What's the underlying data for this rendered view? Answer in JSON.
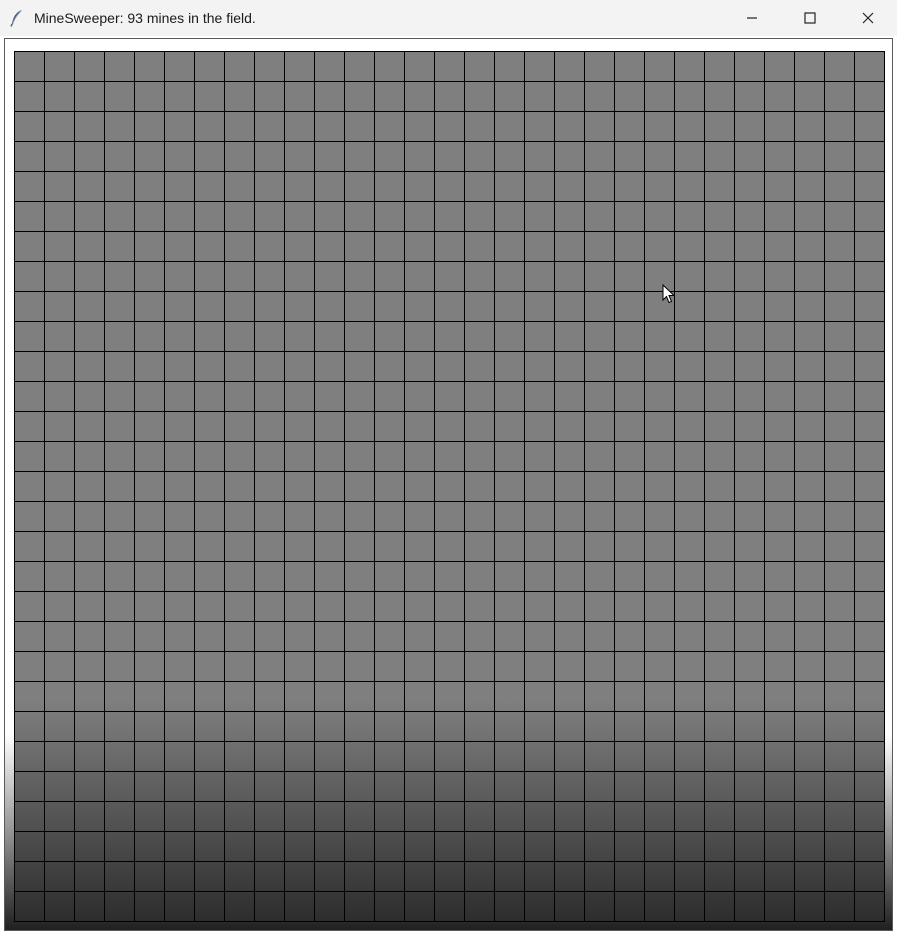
{
  "window": {
    "title": "MineSweeper: 93 mines in the field.",
    "icon": "feather-icon",
    "controls": [
      "minimize-icon",
      "maximize-icon",
      "close-icon"
    ]
  },
  "board": {
    "rows": 29,
    "cols": 29,
    "legend": {
      "H": "hidden",
      ".": "revealed-empty",
      "M": "mine",
      "digit": "revealed-number"
    },
    "grid": [
      "HHHHHHHHHHHHHHHHHHHHHHHHHHHHH",
      "HHHHHHHHHHHHHHHHHHHHHHHHHHHHH",
      "HHHHHHHHHHHHHHHHHHHHHHHHHHHHH",
      "HHHHHHHHHHHHHHHHHHHHHHHHHHHHH",
      "HHHHHHHHHHHHHHHHHHHHHHHHHHHHH",
      "HHHHHHHHHHHHHHHHHHHHHHHHHHHHH",
      "HHHHHHHHHHHHHHHHHHHHHHHHHHHHH",
      "HHHHHHHHHHHHHHHHHHHHHHHHHHHHH",
      "HHHHHHHHHHHHHHHHHHHHHHHHHHHHH",
      "HHHHHHHHHHHHHHHHHHHHHHHHHHHHH",
      "HHHHHHHHHHHHHHHHHHHHHHHHHHHHH",
      "HHHHHHHHHHHHHHHHHHHHHHHHHHHHH",
      "HHHHHHHHHHHHHHHHHHHHHHHHHHHHH",
      "HHHHHHHHHHHHHHHHHHHHHHHHHHHHH",
      "HHHHHHHHHHHHHHHHHHHHHHHHHHHHH",
      "HHHHHHHHHHHHHHHHHHHHHHHHHHHHH",
      "HHHHHHHHHHHHHHHHHHHHHHHHHHHHH",
      "HHHHHHHHHHHHHHHHHHHHHHHHHHHHH",
      "HHHHHHHHHHHHHHHHHHHHHHHHHHHHH",
      "HHHHHHHHHHHHHHHHHHHHHHHHHHHHH",
      "HHHHHHHHHHHHHHHHHHHHHHHHHHHHH",
      "HHHHHHHHHHHHHHHHHHHHHHHHHHHHH",
      "HHHHHHHHHHHHHHHHHHHHHHHHHHHHH",
      "HHHHHHHHHHHHHHHHHHHHHHHHHHHHH",
      "HHHHHHHHHHHHHHHHHHHHHHHHHHHHH",
      "HHHHHHHHHHHHHHHHHHHHHHHHHHHHH",
      "HHHHHHHHHHHHHHHHHHHHHHHHHHHHH",
      "HHHHHHHHHHHHHHHHHHHHHHHHHHHHH",
      "HHHHHHHHHHHHHHHHHHHHHHHHHHHHH"
    ]
  },
  "colors": {
    "cell_fill": "#7f7f7f",
    "grid_line": "#000000",
    "revealed_border": "#b0444a",
    "number": "#d81e1e",
    "mine": "#000000"
  },
  "cursor_icon": "arrow-cursor-icon"
}
